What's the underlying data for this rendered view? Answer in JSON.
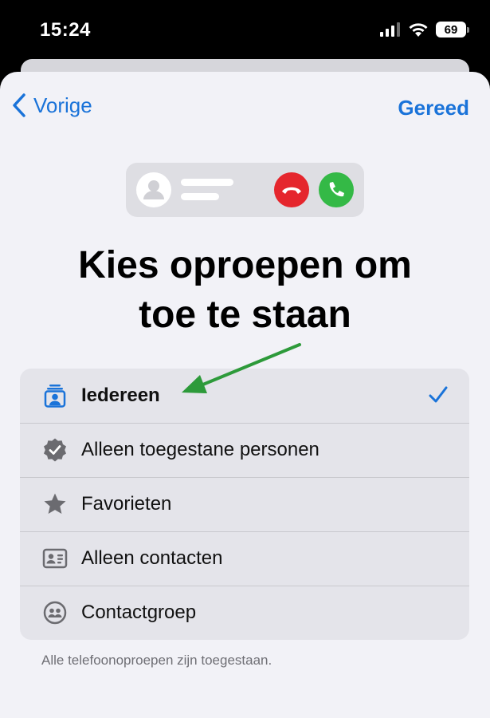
{
  "status_bar": {
    "time": "15:24",
    "battery": "69"
  },
  "nav": {
    "back_label": "Vorige",
    "done_label": "Gereed"
  },
  "title_line1": "Kies oproepen om",
  "title_line2": "toe te staan",
  "options": [
    {
      "label": "Iedereen",
      "icon": "person-badge-icon",
      "selected": true
    },
    {
      "label": "Alleen toegestane personen",
      "icon": "verified-badge-icon",
      "selected": false
    },
    {
      "label": "Favorieten",
      "icon": "star-icon",
      "selected": false
    },
    {
      "label": "Alleen contacten",
      "icon": "contact-card-icon",
      "selected": false
    },
    {
      "label": "Contactgroep",
      "icon": "group-icon",
      "selected": false
    }
  ],
  "footnote": "Alle telefoonoproepen zijn toegestaan.",
  "colors": {
    "accent": "#1a73d9",
    "decline": "#e5262d",
    "accept": "#34b946",
    "annotation_arrow": "#2d9a3a"
  }
}
